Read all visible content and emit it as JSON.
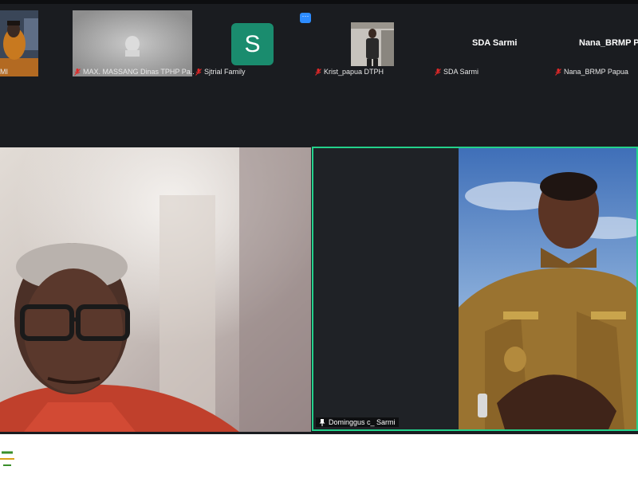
{
  "participants": [
    {
      "name": "MI",
      "muted": false
    },
    {
      "name": "MAX. MASSANG Dinas TPHP Pa...",
      "muted": true
    },
    {
      "name": "Sjtrial Family",
      "muted": true,
      "avatar_letter": "S",
      "avatar_color": "#1a8c6e"
    },
    {
      "name": "Krist_papua DTPH",
      "muted": true
    },
    {
      "name": "SDA Sarmi",
      "muted": true,
      "display_name": "SDA Sarmi"
    },
    {
      "name": "Nana_BRMP Papua",
      "muted": true,
      "display_name": "Nana_BRMP Pa"
    }
  ],
  "more_button": "···",
  "active_speaker": {
    "name": "Dominggus c_ Sarmi",
    "accent": "#23d18b"
  },
  "colors": {
    "background": "#1a1c20",
    "muted_icon": "#e02828",
    "tile": "#2a2c30"
  }
}
